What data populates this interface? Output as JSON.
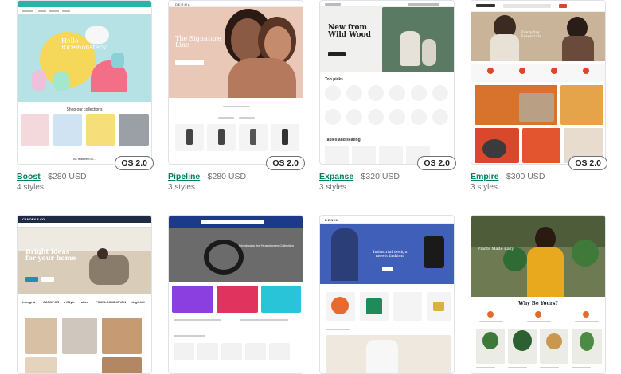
{
  "themes": [
    {
      "name": "Boost",
      "price": "$280 USD",
      "styles": "4 styles",
      "badge": "OS 2.0",
      "preview": {
        "hero_text": "Hello Ricemonsters!",
        "section_title": "Shop our collections",
        "footer_text": "As featured in..."
      }
    },
    {
      "name": "Pipeline",
      "price": "$280 USD",
      "styles": "3 styles",
      "badge": "OS 2.0",
      "preview": {
        "hero_text": "The Signature Line",
        "logo": "DERMA"
      }
    },
    {
      "name": "Expanse",
      "price": "$320 USD",
      "styles": "3 styles",
      "badge": "OS 2.0",
      "preview": {
        "hero_text": "New from Wild Wood",
        "section_title": "Top picks",
        "section_title_2": "Tables and seating"
      }
    },
    {
      "name": "Empire",
      "price": "$300 USD",
      "styles": "3 styles",
      "badge": "OS 2.0",
      "preview": {
        "hero_text": "Everyday Essentials"
      }
    },
    {
      "name": "",
      "price": "",
      "styles": "",
      "badge": "",
      "preview": {
        "hero_text": "Bright ideas for your home",
        "logo": "CANOPY & CO",
        "brands": [
          "horagrid",
          "CANNYOR",
          "irVByle",
          "alize",
          "FOXELCOMB",
          "HOYAN",
          "hinglehill"
        ]
      }
    },
    {
      "name": "",
      "price": "",
      "styles": "",
      "badge": "",
      "preview": {
        "hero_text": "Introducing the Headphones Collection"
      }
    },
    {
      "name": "",
      "price": "",
      "styles": "",
      "badge": "",
      "preview": {
        "hero_text": "Industrial design meets fashion.",
        "logo": "DENIM"
      }
    },
    {
      "name": "",
      "price": "",
      "styles": "",
      "badge": "",
      "preview": {
        "hero_text": "Plants Made Easy",
        "section_title": "Why Be Yours?"
      }
    }
  ]
}
